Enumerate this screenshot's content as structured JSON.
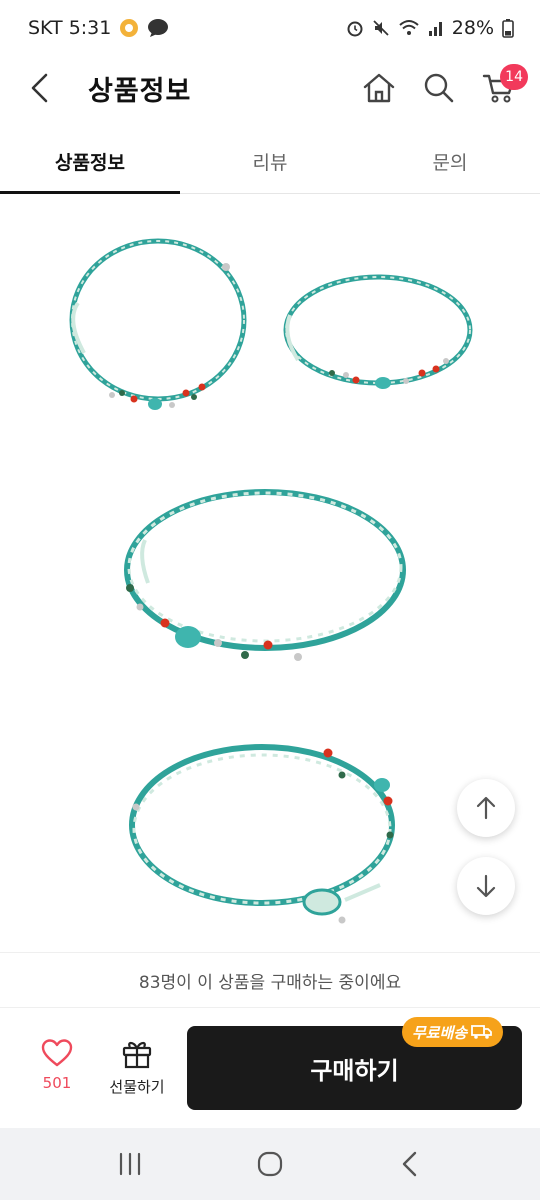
{
  "status_bar": {
    "carrier_time": "SKT 5:31",
    "battery": "28%",
    "icons": [
      "app-notification-icon",
      "chat-bubble-icon",
      "alarm-icon",
      "mute-icon",
      "wifi-icon",
      "signal-icon",
      "battery-icon"
    ]
  },
  "header": {
    "title": "상품정보",
    "cart_count": "14",
    "icons": [
      "back-arrow-icon",
      "home-icon",
      "search-icon",
      "cart-icon"
    ]
  },
  "tabs": [
    {
      "label": "상품정보",
      "active": true
    },
    {
      "label": "리뷰",
      "active": false
    },
    {
      "label": "문의",
      "active": false
    }
  ],
  "product": {
    "image_description": "turquoise braided string bracelets with red, green and silver beads",
    "colors": {
      "cord": "#2fa39a",
      "cord_light": "#cfe9df",
      "red_bead": "#d8321e",
      "green_bead": "#2f6a4a",
      "silver_bead": "#c8c8c8",
      "turquoise_stone": "#3fb5ae"
    }
  },
  "notice": "83명이 이 상품을 구매하는 중이에요",
  "purchase_bar": {
    "like_count": "501",
    "gift_label": "선물하기",
    "buy_label": "구매하기",
    "shipping_badge": "무료배송",
    "accent_color": "#ef4a5c",
    "badge_color": "#f6a21a"
  },
  "nav": {
    "icons": [
      "recent-apps-icon",
      "home-circle-icon",
      "back-icon"
    ]
  }
}
